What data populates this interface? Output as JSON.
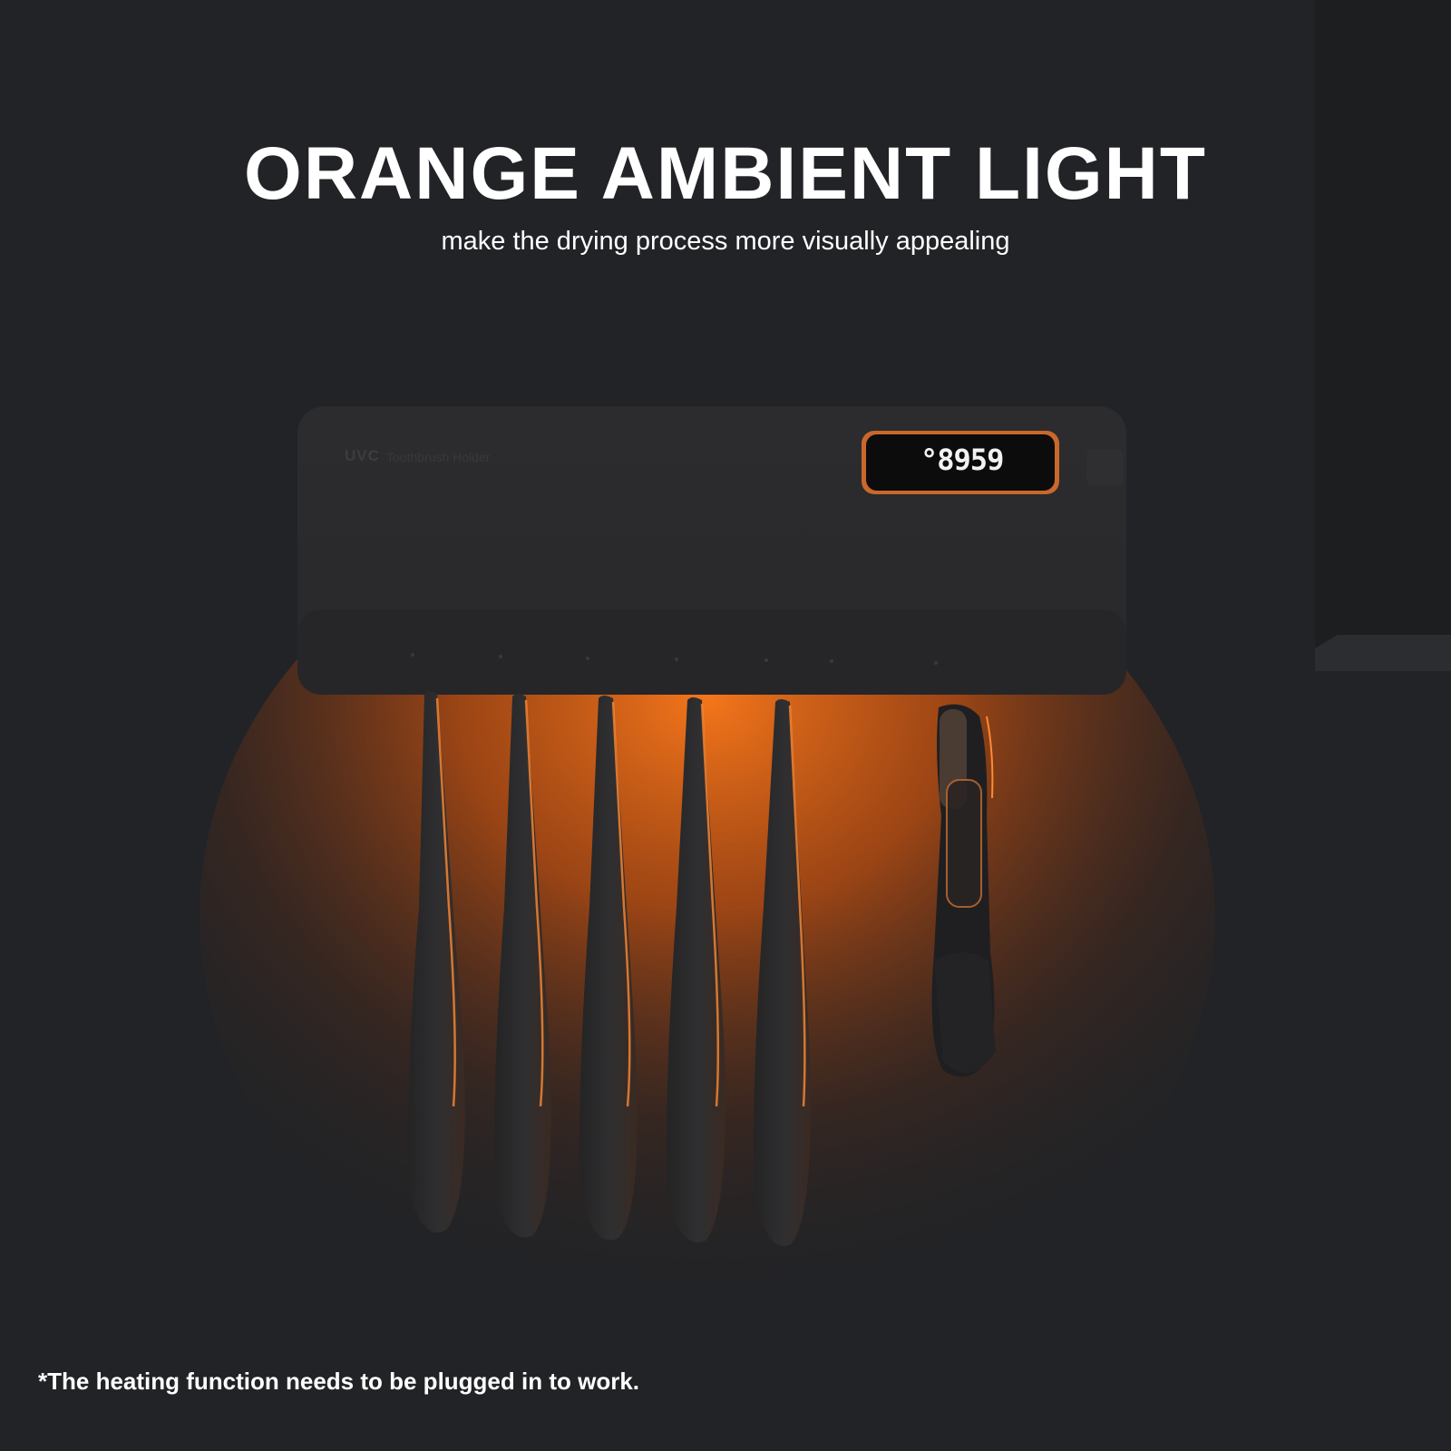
{
  "headline": "ORANGE AMBIENT LIGHT",
  "subheadline": "make the drying process more visually appealing",
  "device": {
    "brand_label": "UVC",
    "brand_sublabel": "Toothbrush Holder",
    "display_reading": "°8959",
    "glow_color": "#ff7a1a"
  },
  "footnote": "*The heating function needs to be plugged in to work."
}
